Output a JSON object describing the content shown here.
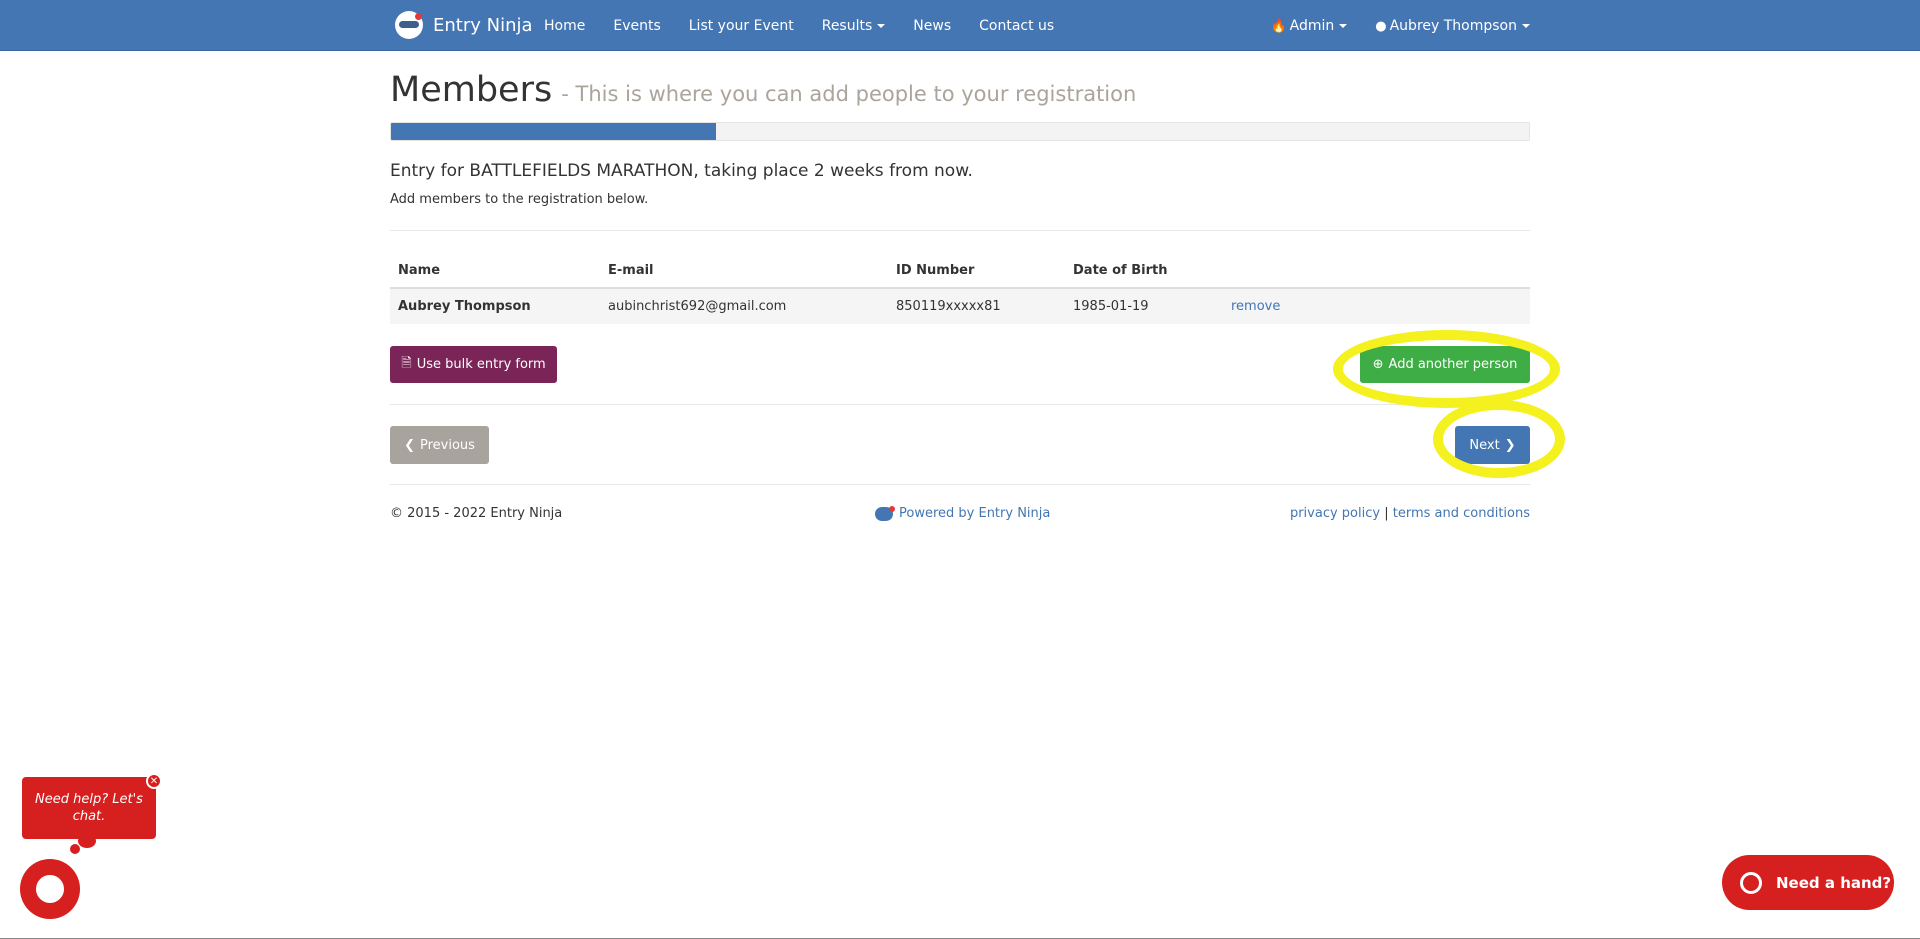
{
  "navbar": {
    "brand": "Entry Ninja",
    "links": [
      "Home",
      "Events",
      "List your Event",
      "Results",
      "News",
      "Contact us"
    ],
    "admin_label": "Admin",
    "user_label": "Aubrey Thompson"
  },
  "page": {
    "title": "Members",
    "subtitle": "- This is where you can add people to your registration",
    "progress_percent": 28.6,
    "entry_text": "Entry for BATTLEFIELDS MARATHON, taking place 2 weeks from now.",
    "add_text": "Add members to the registration below."
  },
  "table": {
    "headers": [
      "Name",
      "E-mail",
      "ID Number",
      "Date of Birth"
    ],
    "rows": [
      {
        "name": "Aubrey Thompson",
        "email": "aubinchrist692@gmail.com",
        "id_number": "850119xxxxx81",
        "dob": "1985-01-19",
        "action": "remove"
      }
    ]
  },
  "buttons": {
    "bulk": "Use bulk entry form",
    "add": "Add another person",
    "previous": "Previous",
    "next": "Next"
  },
  "footer": {
    "copyright": "© 2015 - 2022 Entry Ninja",
    "powered": "Powered by Entry Ninja",
    "privacy": "privacy policy",
    "separator": "|",
    "terms": "terms and conditions"
  },
  "chat": {
    "bubble_text": "Need help? Let's chat.",
    "help_button": "Need a hand?"
  },
  "colors": {
    "navbar": "#4376b3",
    "bulk_button": "#7a2457",
    "add_button": "#3fad46",
    "previous_button": "#a8a39c",
    "next_button": "#4376b3",
    "chat_red": "#d61f1f",
    "highlight": "#f4f11f"
  }
}
